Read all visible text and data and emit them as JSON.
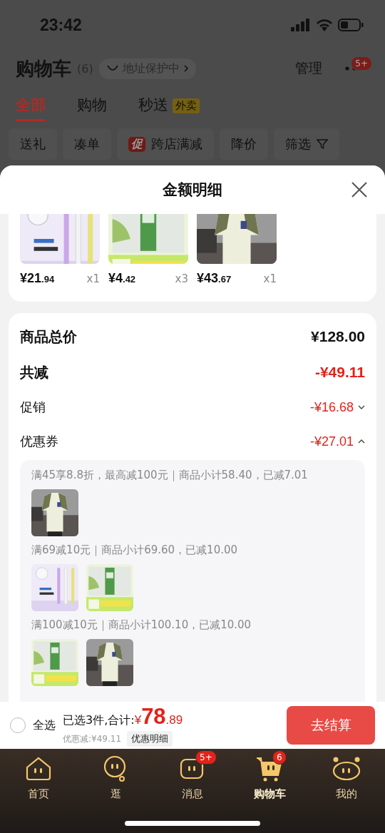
{
  "status_bar": {
    "time": "23:42"
  },
  "header": {
    "title": "购物车",
    "count": "(6)",
    "address": "地址保护中",
    "manage": "管理",
    "more_badge": "5+"
  },
  "tabs": [
    {
      "label": "全部",
      "selected": true
    },
    {
      "label": "购物",
      "selected": false
    },
    {
      "label": "秒送",
      "selected": false,
      "badge": "外卖"
    }
  ],
  "filters": [
    {
      "label": "送礼"
    },
    {
      "label": "凑单"
    },
    {
      "label": "跨店满减",
      "tag": "促"
    },
    {
      "label": "降价"
    },
    {
      "label": "筛选",
      "kind": "filter"
    }
  ],
  "sheet": {
    "title": "金额明细",
    "products": [
      {
        "kind": "picture",
        "price": "¥21.94",
        "qty": "x1"
      },
      {
        "kind": "picture",
        "price": "¥4.42",
        "qty": "x3"
      },
      {
        "kind": "picture",
        "price": "¥43.67",
        "qty": "x1"
      }
    ],
    "summary": [
      {
        "label": "商品总价",
        "value": "¥128.00",
        "kind": "total"
      },
      {
        "label": "共减",
        "value": "-¥49.11",
        "kind": "discount"
      },
      {
        "label": "促销",
        "value": "-¥16.68",
        "kind": "detail",
        "expanded": false
      },
      {
        "label": "优惠券",
        "value": "-¥27.01",
        "kind": "detail",
        "expanded": true
      }
    ],
    "coupons": [
      {
        "text": "满45享8.8折，最高减100元｜商品小计58.40，已减7.01"
      },
      {
        "text": "满69减10元｜商品小计69.60，已减10.00"
      },
      {
        "text": "满100减10元｜商品小计100.10，已减10.00"
      }
    ]
  },
  "checkout": {
    "select_all": {
      "label": "全选",
      "checked": false
    },
    "selected_text": "已选3件,合计:",
    "total": "¥78.89",
    "saved": "优惠减:¥49.11",
    "detail_button": "优惠明细",
    "button": "去结算"
  },
  "nav": [
    {
      "label": "首页",
      "selected": false
    },
    {
      "label": "逛",
      "selected": false
    },
    {
      "label": "消息",
      "selected": false,
      "badge": "5+"
    },
    {
      "label": "购物车",
      "selected": true,
      "badge": "6"
    },
    {
      "label": "我的",
      "selected": false
    }
  ]
}
